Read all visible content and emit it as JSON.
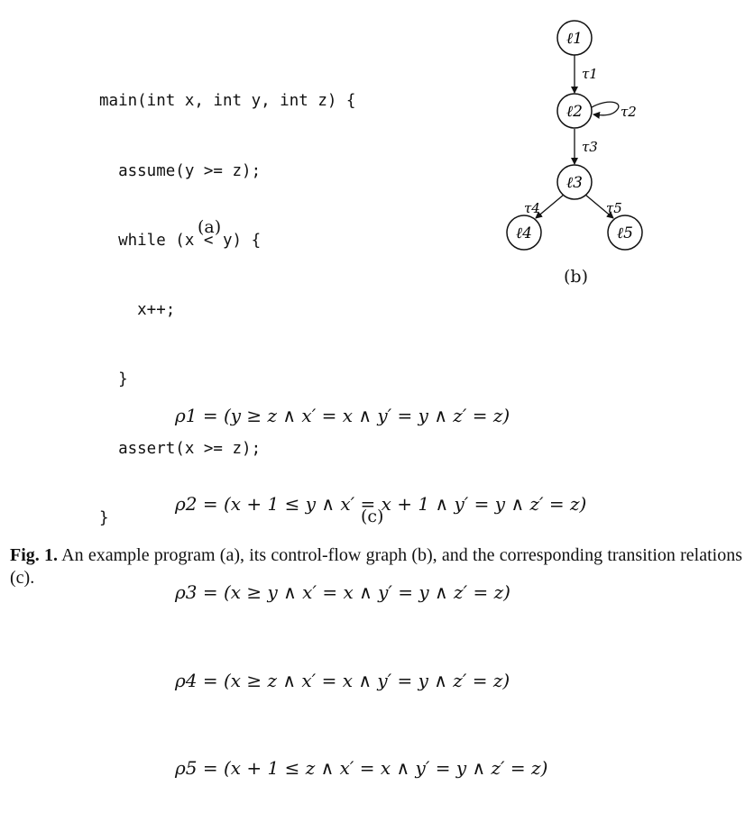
{
  "code": {
    "lines": [
      "main(int x, int y, int z) {",
      "  assume(y >= z);",
      "  while (x < y) {",
      "    x++;",
      "  }",
      "  assert(x >= z);",
      "}"
    ]
  },
  "labels": {
    "a": "(a)",
    "b": "(b)",
    "c": "(c)"
  },
  "graph": {
    "nodes": [
      "ℓ1",
      "ℓ2",
      "ℓ3",
      "ℓ4",
      "ℓ5"
    ],
    "edges": [
      "τ1",
      "τ2",
      "τ3",
      "τ4",
      "τ5"
    ]
  },
  "relations": [
    "ρ1 = (y ≥ z ∧ x′ = x ∧ y′ = y ∧ z′ = z)",
    "ρ2 = (x + 1 ≤ y ∧ x′ = x + 1 ∧ y′ = y ∧ z′ = z)",
    "ρ3 = (x ≥ y ∧ x′ = x ∧ y′ = y ∧ z′ = z)",
    "ρ4 = (x ≥ z ∧ x′ = x ∧ y′ = y ∧ z′ = z)",
    "ρ5 = (x + 1 ≤ z ∧ x′ = x ∧ y′ = y ∧ z′ = z)"
  ],
  "caption": {
    "label": "Fig. 1.",
    "text": " An example program (a), its control-flow graph (b), and the corresponding transition relations (c)."
  }
}
